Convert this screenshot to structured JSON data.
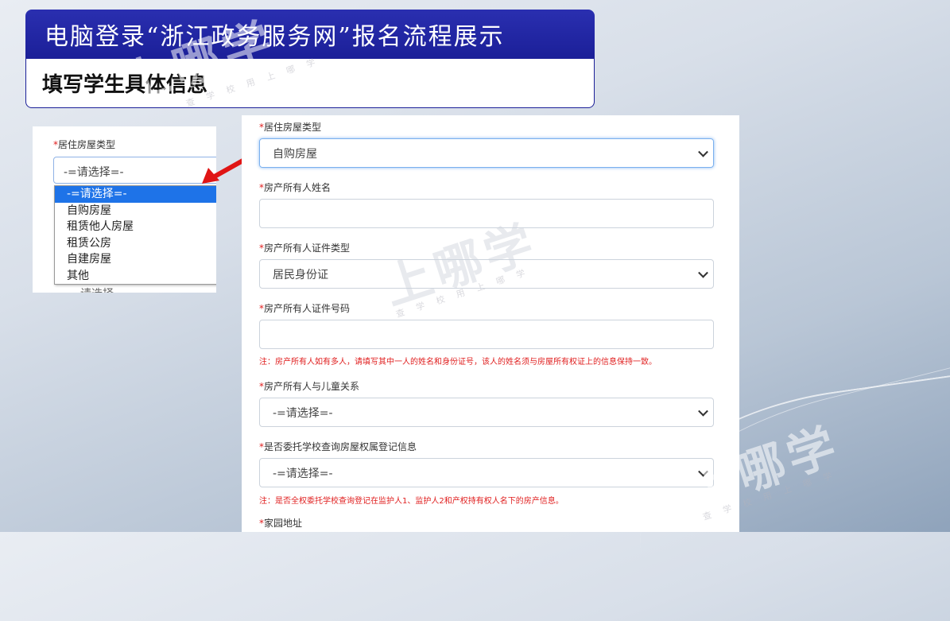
{
  "header": {
    "title": "电脑登录“浙江政务服务网”报名流程展示",
    "subtitle": "填写学生具体信息"
  },
  "watermark": {
    "text": "上哪学",
    "small": "查 学 校    用 上 哪 学"
  },
  "left_panel": {
    "label": "居住房屋类型",
    "required_mark": "*",
    "select_value": "-=请选择=-",
    "options": [
      "-=请选择=-",
      "自购房屋",
      "租赁他人房屋",
      "租赁公房",
      "自建房屋",
      "其他"
    ],
    "cut_text": "请选择"
  },
  "form": {
    "required_mark": "*",
    "fields": [
      {
        "label": "居住房屋类型",
        "value": "自购房屋"
      },
      {
        "label": "房产所有人姓名",
        "value": ""
      },
      {
        "label": "房产所有人证件类型",
        "value": "居民身份证"
      },
      {
        "label": "房产所有人证件号码",
        "value": ""
      },
      {
        "label": "房产所有人与儿童关系",
        "value": "-=请选择=-"
      },
      {
        "label": "是否委托学校查询房屋权属登记信息",
        "value": "-=请选择=-"
      }
    ],
    "note1": "注：房产所有人如有多人，请填写其中一人的姓名和身份证号，该人的姓名须与房屋所有权证上的信息保持一致。",
    "note2": "注：是否全权委托学校查询登记在监护人1、监护人2和产权持有权人名下的房产信息。",
    "cut_label": "家园地址"
  },
  "colors": {
    "title_bg": "#1b1f98",
    "required": "#e02020",
    "selected_option": "#1e73e8",
    "arrow": "#e01515"
  }
}
